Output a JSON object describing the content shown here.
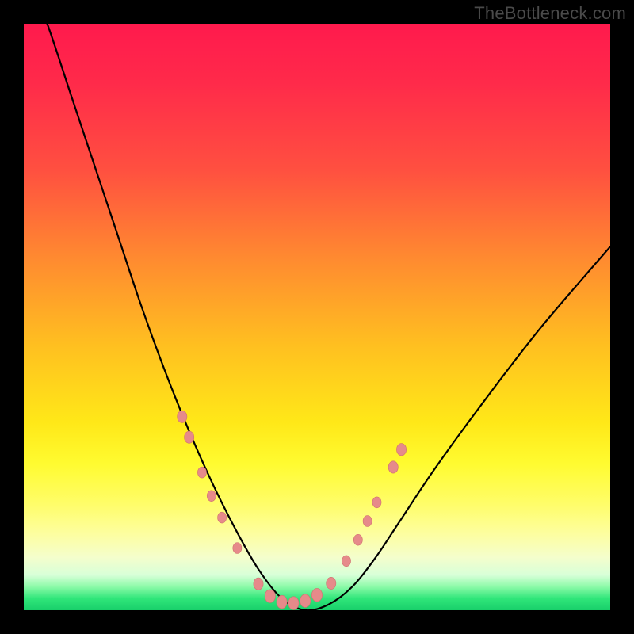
{
  "watermark": "TheBottleneck.com",
  "colors": {
    "curve_stroke": "#000000",
    "marker_fill": "#e68a8a",
    "marker_stroke": "#d07070",
    "gradient_top": "#ff1a4d",
    "gradient_bottom": "#18cf6a",
    "background": "#000000"
  },
  "chart_data": {
    "type": "line",
    "title": "",
    "xlabel": "",
    "ylabel": "",
    "xlim": [
      0,
      100
    ],
    "ylim": [
      0,
      100
    ],
    "notes": "Bottleneck-style curve: y is approximate bottleneck % (0 = balanced/green at bottom, 100 = severe/red at top). Valley of salmon markers near x≈36–52 indicates balanced region. No numeric axis labels visible in source.",
    "series": [
      {
        "name": "bottleneck-curve",
        "x": [
          0,
          4,
          8,
          12,
          16,
          20,
          24,
          28,
          32,
          36,
          40,
          44,
          48,
          52,
          56,
          60,
          64,
          70,
          78,
          88,
          100
        ],
        "y": [
          110,
          100,
          88,
          76,
          64,
          52,
          41,
          31,
          22,
          14,
          7,
          2,
          0,
          1,
          4,
          9,
          15,
          24,
          35,
          48,
          62
        ]
      }
    ],
    "markers": [
      {
        "x": 27.0,
        "y": 33.0,
        "r": 1.1
      },
      {
        "x": 28.2,
        "y": 29.5,
        "r": 1.1
      },
      {
        "x": 30.4,
        "y": 23.5,
        "r": 1.0
      },
      {
        "x": 32.0,
        "y": 19.5,
        "r": 1.0
      },
      {
        "x": 33.8,
        "y": 15.8,
        "r": 1.0
      },
      {
        "x": 36.4,
        "y": 10.6,
        "r": 1.0
      },
      {
        "x": 40.0,
        "y": 4.5,
        "r": 1.1
      },
      {
        "x": 42.0,
        "y": 2.4,
        "r": 1.2
      },
      {
        "x": 44.0,
        "y": 1.4,
        "r": 1.2
      },
      {
        "x": 46.0,
        "y": 1.2,
        "r": 1.2
      },
      {
        "x": 48.0,
        "y": 1.6,
        "r": 1.2
      },
      {
        "x": 50.0,
        "y": 2.6,
        "r": 1.2
      },
      {
        "x": 52.4,
        "y": 4.6,
        "r": 1.1
      },
      {
        "x": 55.0,
        "y": 8.4,
        "r": 1.0
      },
      {
        "x": 57.0,
        "y": 12.0,
        "r": 1.0
      },
      {
        "x": 58.6,
        "y": 15.2,
        "r": 1.0
      },
      {
        "x": 60.2,
        "y": 18.4,
        "r": 1.0
      },
      {
        "x": 63.0,
        "y": 24.4,
        "r": 1.1
      },
      {
        "x": 64.4,
        "y": 27.4,
        "r": 1.1
      }
    ]
  }
}
